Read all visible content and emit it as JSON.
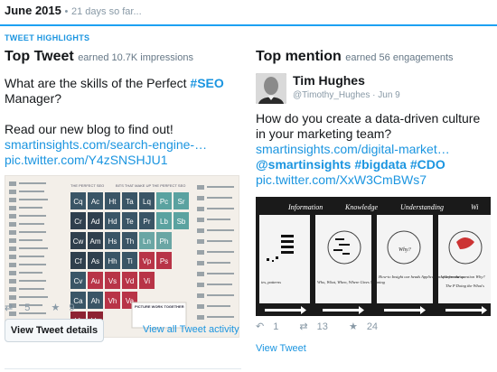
{
  "header": {
    "month": "June 2015",
    "separator": "•",
    "days": "21 days so far..."
  },
  "highlights_label": "TWEET HIGHLIGHTS",
  "top_tweet": {
    "title": "Top Tweet",
    "subtitle": "earned 10.7K impressions",
    "text_before": "What are the skills of the Perfect ",
    "hashtag": "#SEO",
    "text_after": " Manager?",
    "text2": "Read our new blog to find out!",
    "link1": "smartinsights.com/search-engine-…",
    "link2": "pic.twitter.com/Y4zSNSHJU1",
    "retweets": "5",
    "likes": "9",
    "details_button": "View Tweet details",
    "all_activity_link": "View all Tweet activity"
  },
  "top_mention": {
    "title": "Top mention",
    "subtitle": "earned 56 engagements",
    "author_name": "Tim Hughes",
    "author_handle": "@Timothy_Hughes · Jun 9",
    "text": "How do you create a data-driven culture in your marketing team?",
    "link1": "smartinsights.com/digital-market…",
    "mention": "@smartinsights",
    "tag1": "#bigdata",
    "tag2": "#CDO",
    "link2": "pic.twitter.com/XxW3CmBWs7",
    "replies": "1",
    "retweets": "13",
    "likes": "24",
    "view_link": "View Tweet"
  },
  "image_left": {
    "table_header_left": "THE PERFECT SEO",
    "table_header_right": "BITS THAT MAKE UP THE PERFECT SEO",
    "elements": [
      "Cq",
      "Ac",
      "Ht",
      "Ta",
      "Lq",
      "Pc",
      "Sr",
      "Cr",
      "Ad",
      "Hd",
      "Te",
      "Pr",
      "Lb",
      "Sb",
      "Cw",
      "Am",
      "Hs",
      "Th",
      "Ln",
      "Ph",
      "Cf",
      "As",
      "Hh",
      "Ti",
      "Vp",
      "Ps",
      "Cv",
      "Au",
      "Vs",
      "Vd",
      "Vi",
      "Ca",
      "Ah",
      "Vh",
      "Va",
      "Vt",
      "Vc"
    ],
    "footer_label": "PICTURE WORK TOGETHER"
  },
  "image_right": {
    "headers": [
      "Information",
      "Knowledge",
      "Understanding",
      "Wi"
    ],
    "captions": [
      "ies, patterns",
      "Who, What, When, Where Gives Meaning",
      "How-to Insight our heads Application of Information",
      "Answers the question Why?",
      "The P Doing the What's"
    ],
    "why_label": "Why?"
  }
}
